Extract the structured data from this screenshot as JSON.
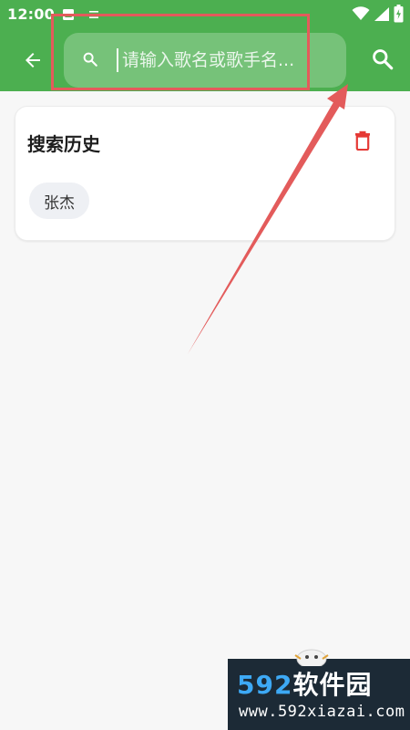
{
  "status_bar": {
    "time": "12:00"
  },
  "search": {
    "placeholder": "请输入歌名或歌手名..."
  },
  "history": {
    "title": "搜索历史",
    "items": [
      {
        "label": "张杰"
      }
    ]
  },
  "watermark": {
    "brand_number": "592",
    "brand_text": "软件园",
    "url": "www.592xiazai.com"
  },
  "colors": {
    "header_green": "#4caf50",
    "delete_red": "#e53935",
    "annotation_red": "#e35b5b",
    "background": "#f7f7f7"
  },
  "icons": {
    "back": "arrow-left-icon",
    "search": "search-icon",
    "delete": "trash-icon"
  }
}
